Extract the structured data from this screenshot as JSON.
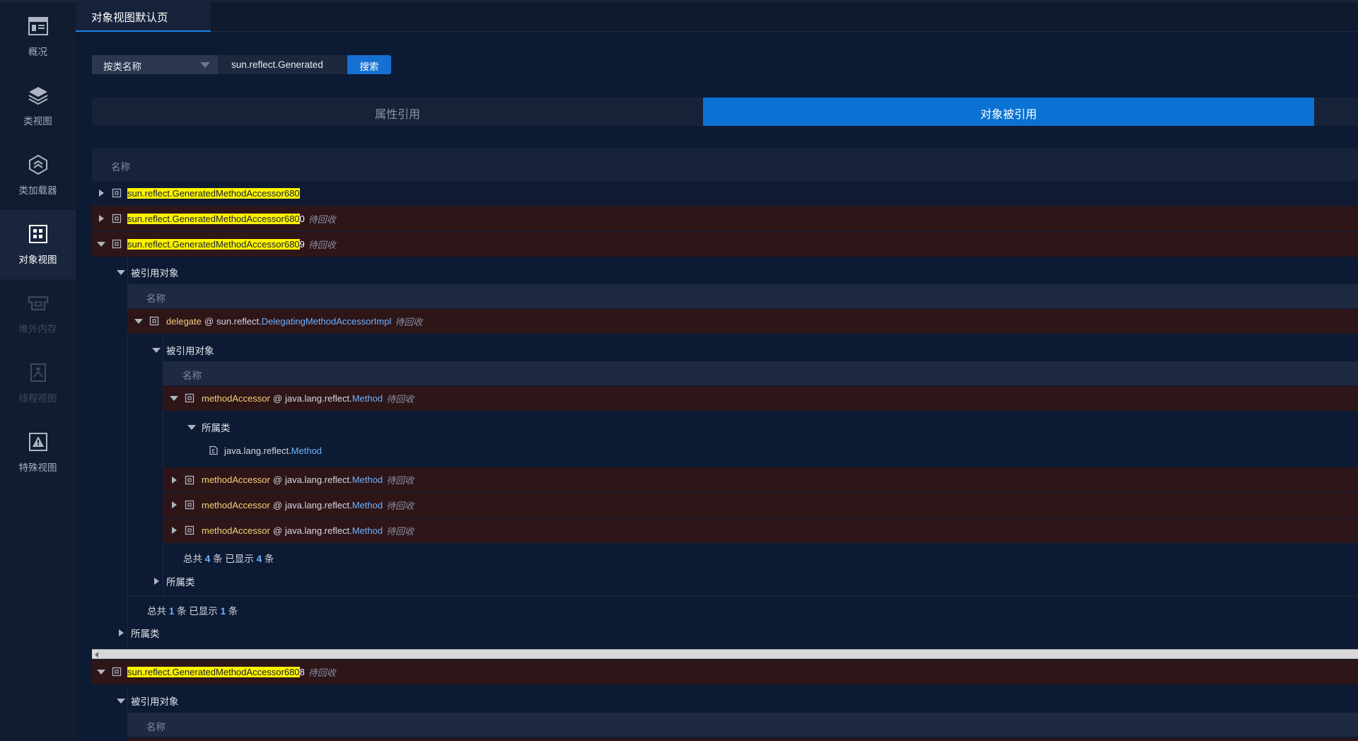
{
  "sidebar": {
    "items": [
      {
        "label": "概况",
        "icon": "overview-icon",
        "state": "normal"
      },
      {
        "label": "类视图",
        "icon": "layers-icon",
        "state": "normal"
      },
      {
        "label": "类加载器",
        "icon": "classloader-icon",
        "state": "normal"
      },
      {
        "label": "对象视图",
        "icon": "object-view-icon",
        "state": "active"
      },
      {
        "label": "堆外内存",
        "icon": "offheap-memory-icon",
        "state": "disabled"
      },
      {
        "label": "线程视图",
        "icon": "thread-view-icon",
        "state": "disabled"
      },
      {
        "label": "特殊视图",
        "icon": "warning-icon",
        "state": "normal"
      }
    ]
  },
  "tabs": {
    "active_label": "对象视图默认页"
  },
  "search": {
    "mode_selected": "按类名称",
    "query": "sun.reflect.Generated",
    "button_label": "搜索"
  },
  "segments": {
    "left": "属性引用",
    "right": "对象被引用",
    "active": "right"
  },
  "table": {
    "header": "名称",
    "rows": [
      {
        "hl": "sun.reflect.GeneratedMethodAccessor680",
        "rest": "",
        "status": ""
      },
      {
        "hl": "sun.reflect.GeneratedMethodAccessor680",
        "rest": "0",
        "status": "待回收"
      },
      {
        "hl": "sun.reflect.GeneratedMethodAccessor680",
        "rest": "9",
        "status": "待回收"
      },
      {
        "hl": "sun.reflect.GeneratedMethodAccessor680",
        "rest": "8",
        "status": "待回收"
      }
    ],
    "referenced_label": "被引用对象",
    "owner_class_label": "所属类",
    "level2": {
      "header": "名称",
      "field": "delegate",
      "at": "@",
      "pkg": "sun.reflect.",
      "cls": "DelegatingMethodAccessorImpl",
      "status": "待回收"
    },
    "level3": {
      "header": "名称",
      "rows": [
        {
          "field": "methodAccessor",
          "at": "@",
          "pkg": "java.lang.reflect.",
          "cls": "Method",
          "status": "待回收"
        },
        {
          "field": "methodAccessor",
          "at": "@",
          "pkg": "java.lang.reflect.",
          "cls": "Method",
          "status": "待回收"
        },
        {
          "field": "methodAccessor",
          "at": "@",
          "pkg": "java.lang.reflect.",
          "cls": "Method",
          "status": "待回收"
        },
        {
          "field": "methodAccessor",
          "at": "@",
          "pkg": "java.lang.reflect.",
          "cls": "Method",
          "status": "待回收"
        }
      ],
      "owner_class": {
        "pkg": "java.lang.reflect.",
        "cls": "Method"
      }
    },
    "totals_inner": {
      "t1": "总共",
      "count": "4",
      "t2": "条 已显示",
      "shown": "4",
      "t3": "条"
    },
    "totals_outer": {
      "t1": "总共",
      "count": "1",
      "t2": "条 已显示",
      "shown": "1",
      "t3": "条"
    }
  },
  "colors": {
    "accent": "#0a72d2",
    "highlight": "#fff200",
    "pending_row": "#2e1518",
    "link": "#6cb4ff",
    "field": "#f3d27a"
  }
}
